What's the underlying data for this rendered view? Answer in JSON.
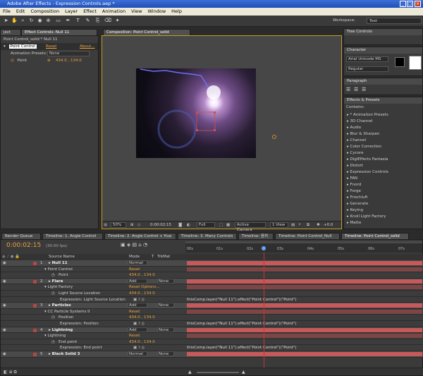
{
  "app": {
    "title": "Adobe After Effects - Expression Controls.aep *"
  },
  "menu": [
    "File",
    "Edit",
    "Composition",
    "Layer",
    "Effect",
    "Animation",
    "View",
    "Window",
    "Help"
  ],
  "workspace": {
    "label": "Workspace:",
    "value": "Text"
  },
  "effect_controls": {
    "tab_project": "ject",
    "tab": "Effect Controls: Null 11",
    "breadcrumb": "Point Control_solid * Null 11",
    "effect_name": "Point Control",
    "reset": "Reset",
    "about": "About...",
    "preset_label": "Animation Presets:",
    "preset_value": "None",
    "param": "Point",
    "value": "434.0 , 134.0"
  },
  "composition": {
    "tab": "Composition: Point Control_solid",
    "zoom": "50%",
    "time": "0:00:02:15",
    "quality": "Full",
    "camera": "Active Camera",
    "view": "1 View",
    "offset": "+0.0"
  },
  "tree_controls": {
    "tab": "Tree Controls"
  },
  "character": {
    "tab": "Character",
    "font": "Arial Unicode MS",
    "style": "Regular"
  },
  "paragraph": {
    "tab": "Paragraph"
  },
  "effects_presets": {
    "tab": "Effects & Presets",
    "contains": "Contains:",
    "items": [
      "* Animation Presets",
      "3D Channel",
      "Audio",
      "Blur & Sharpen",
      "Channel",
      "Color Correction",
      "Cycore",
      "DigiEffects Fantasia",
      "Distort",
      "Expression Controls",
      "FAN",
      "Fnord",
      "Forge",
      "Frischluft",
      "Generate",
      "Keying",
      "Knoll Light Factory",
      "Matte"
    ]
  },
  "timeline": {
    "tabs": [
      "Render Queue",
      "Timeline: 1. Angle Control",
      "Timeline: 2. Angle Control + Hue",
      "Timeline: 3. Many Controls",
      "Timeline: 음치",
      "Timeline: Point Control_Null",
      "Timeline: Point Control_solid"
    ],
    "timecode": "0:00:02:15",
    "fps": "(30.00 fps)",
    "col_source": "Source Name",
    "col_mode": "Mode",
    "col_t": "T",
    "col_trkmat": "TrkMat",
    "ruler": [
      "00s",
      "01s",
      "02s",
      "03s",
      "04s",
      "05s",
      "06s",
      "07s"
    ],
    "layers": [
      {
        "num": "1",
        "name": "Null 11",
        "mode": "Normal",
        "trk": "",
        "color": "#b04848",
        "type": "layer"
      },
      {
        "name": "Point Control",
        "extra": "Reset",
        "type": "effect"
      },
      {
        "name": "Point",
        "value": "434.0 , 134.0",
        "type": "prop"
      },
      {
        "num": "2",
        "name": "Flare",
        "mode": "Add",
        "trk": "None",
        "color": "#b04848",
        "type": "layer"
      },
      {
        "name": "Light Factory",
        "extra": "Reset  Options...",
        "type": "effect"
      },
      {
        "name": "Light Source Location",
        "value": "434.0 , 134.0",
        "type": "prop"
      },
      {
        "name": "Expression: Light Source Location",
        "expr": "thisComp.layer(\"Null 11\").effect(\"Point Control\")(\"Point\")",
        "type": "expr"
      },
      {
        "num": "3",
        "name": "Particles",
        "mode": "Add",
        "trk": "None",
        "color": "#b04848",
        "type": "layer"
      },
      {
        "name": "CC Particle Systems II",
        "extra": "Reset",
        "type": "effect"
      },
      {
        "name": "Position",
        "value": "434.0 , 134.0",
        "type": "prop"
      },
      {
        "name": "Expression: Position",
        "expr": "thisComp.layer(\"Null 11\").effect(\"Point Control\")(\"Point\")",
        "type": "expr"
      },
      {
        "num": "4",
        "name": "Lightning",
        "mode": "Add",
        "trk": "None",
        "color": "#b04848",
        "type": "layer"
      },
      {
        "name": "Lightning",
        "extra": "Reset",
        "type": "effect"
      },
      {
        "name": "End point",
        "value": "434.0 , 134.0",
        "type": "prop"
      },
      {
        "name": "Expression: End point",
        "expr": "thisComp.layer(\"Null 11\").effect(\"Point Control\")(\"Point\")",
        "type": "expr"
      },
      {
        "num": "5",
        "name": "Black Solid 3",
        "mode": "Normal",
        "trk": "None",
        "color": "#b04848",
        "type": "layer"
      }
    ]
  }
}
